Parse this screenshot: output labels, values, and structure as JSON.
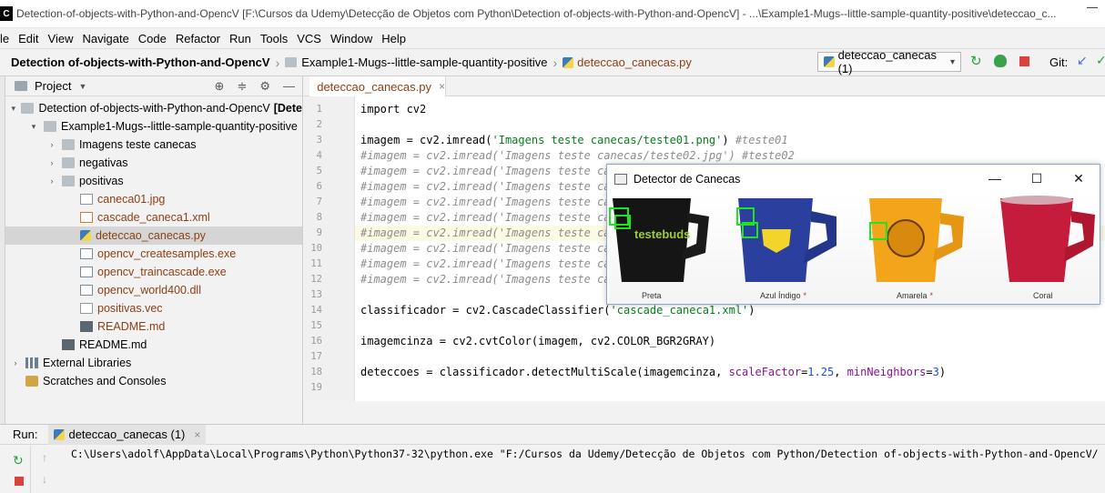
{
  "window": {
    "title": "Detection-of-objects-with-Python-and-OpencV [F:\\Cursos da Udemy\\Detecção de Objetos com Python\\Detection of-objects-with-Python-and-OpencV] - ...\\Example1-Mugs--little-sample-quantity-positive\\deteccao_c..."
  },
  "menu": [
    "le",
    "Edit",
    "View",
    "Navigate",
    "Code",
    "Refactor",
    "Run",
    "Tools",
    "VCS",
    "Window",
    "Help"
  ],
  "breadcrumbs": {
    "project": "Detection of-objects-with-Python-and-OpencV",
    "folder": "Example1-Mugs--little-sample-quantity-positive",
    "file": "deteccao_canecas.py"
  },
  "toolbar": {
    "run_config": "deteccao_canecas (1)",
    "git_label": "Git:"
  },
  "project_panel": {
    "title": "Project",
    "tree": [
      {
        "label": "Detection of-objects-with-Python-and-OpencV",
        "suffix": "[Dete",
        "level": 0,
        "arrow": "▾",
        "icon": "folder"
      },
      {
        "label": "Example1-Mugs--little-sample-quantity-positive",
        "level": 1,
        "arrow": "▾",
        "icon": "folder"
      },
      {
        "label": "Imagens teste canecas",
        "level": 2,
        "arrow": "›",
        "icon": "folder"
      },
      {
        "label": "negativas",
        "level": 2,
        "arrow": "›",
        "icon": "folder"
      },
      {
        "label": "positivas",
        "level": 2,
        "arrow": "›",
        "icon": "folder"
      },
      {
        "label": "caneca01.jpg",
        "level": 3,
        "icon": "image",
        "color": "brown"
      },
      {
        "label": "cascade_caneca1.xml",
        "level": 3,
        "icon": "xml",
        "color": "brown"
      },
      {
        "label": "deteccao_canecas.py",
        "level": 3,
        "icon": "python",
        "color": "brown",
        "selected": true
      },
      {
        "label": "opencv_createsamples.exe",
        "level": 3,
        "icon": "exe",
        "color": "brown"
      },
      {
        "label": "opencv_traincascade.exe",
        "level": 3,
        "icon": "exe",
        "color": "brown"
      },
      {
        "label": "opencv_world400.dll",
        "level": 3,
        "icon": "exe",
        "color": "brown"
      },
      {
        "label": "positivas.vec",
        "level": 3,
        "icon": "vec",
        "color": "brown"
      },
      {
        "label": "README.md",
        "level": 3,
        "icon": "md",
        "color": "brown"
      },
      {
        "label": "README.md",
        "level": 2,
        "icon": "md"
      },
      {
        "label": "External Libraries",
        "level": 0,
        "arrow": "›",
        "icon": "lib"
      },
      {
        "label": "Scratches and Consoles",
        "level": 0,
        "icon": "scratch"
      }
    ]
  },
  "editor": {
    "tab_label": "deteccao_canecas.py",
    "line_numbers": [
      "1",
      "2",
      "3",
      "4",
      "5",
      "6",
      "7",
      "8",
      "9",
      "10",
      "11",
      "12",
      "13",
      "14",
      "15",
      "16",
      "17",
      "18",
      "19"
    ],
    "lines": [
      "import cv2",
      "",
      "imagem = cv2.imread('Imagens teste canecas/teste01.png') #teste01",
      "#imagem = cv2.imread('Imagens teste canecas/teste02.jpg') #teste02",
      "#imagem = cv2.imread('Imagens teste ca",
      "#imagem = cv2.imread('Imagens teste ca",
      "#imagem = cv2.imread('Imagens teste ca",
      "#imagem = cv2.imread('Imagens teste ca",
      "#imagem = cv2.imread('Imagens teste ca",
      "#imagem = cv2.imread('Imagens teste ca",
      "#imagem = cv2.imread('Imagens teste ca",
      "#imagem = cv2.imread('Imagens teste ca",
      "",
      "classificador = cv2.CascadeClassifier('cascade_caneca1.xml')",
      "",
      "imagemcinza = cv2.cvtColor(imagem, cv2.COLOR_BGR2GRAY)",
      "",
      "deteccoes = classificador.detectMultiScale(imagemcinza, scaleFactor=1.25, minNeighbors=3)",
      ""
    ]
  },
  "run_panel": {
    "label": "Run:",
    "tab": "deteccao_canecas (1)",
    "command": "C:\\Users\\adolf\\AppData\\Local\\Programs\\Python\\Python37-32\\python.exe \"F:/Cursos da Udemy/Detecção de Objetos com Python/Detection of-objects-with-Python-and-OpencV/"
  },
  "detector_window": {
    "title": "Detector de Canecas",
    "mugs": [
      {
        "label": "Preta",
        "color": "#1a1a1a",
        "starred": false,
        "brand": "testebuds"
      },
      {
        "label": "Azul Índigo",
        "color": "#2b3f9e",
        "starred": true,
        "brand": ""
      },
      {
        "label": "Amarela",
        "color": "#f2a51a",
        "starred": true,
        "brand": ""
      },
      {
        "label": "Coral",
        "color": "#c41c3a",
        "starred": false,
        "brand": ""
      }
    ],
    "star": "*"
  },
  "colors": {
    "accent_green": "#1fe51f",
    "file_brown": "#8c3f14",
    "string_green": "#067d17"
  }
}
